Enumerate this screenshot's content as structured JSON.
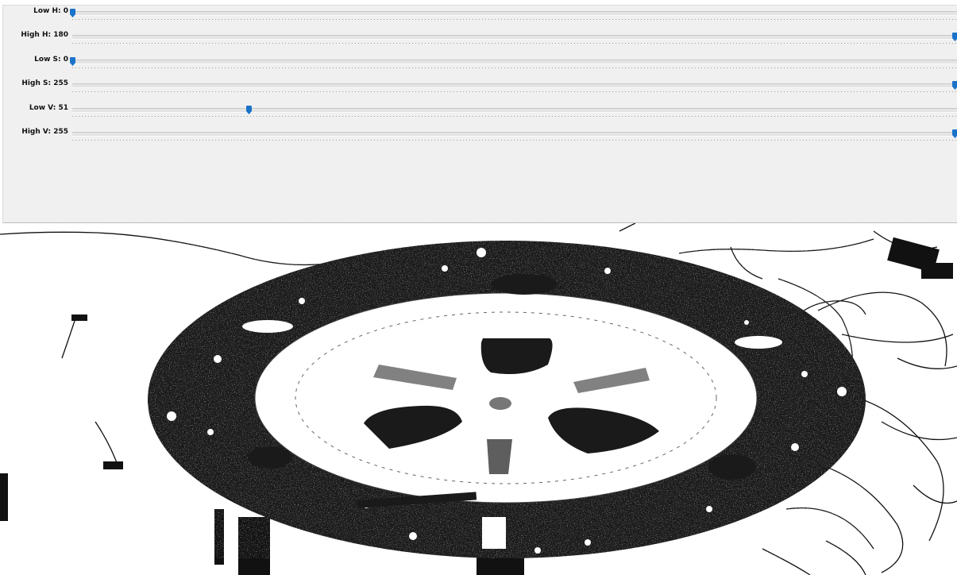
{
  "sliders": [
    {
      "label": "Low H: 0",
      "value": 0,
      "max": 180
    },
    {
      "label": "High H: 180",
      "value": 180,
      "max": 180
    },
    {
      "label": "Low S: 0",
      "value": 0,
      "max": 255
    },
    {
      "label": "High S: 255",
      "value": 255,
      "max": 255
    },
    {
      "label": "Low V: 51",
      "value": 51,
      "max": 255
    },
    {
      "label": "High V: 255",
      "value": 255,
      "max": 255
    }
  ],
  "colors": {
    "accent": "#1a73c9",
    "panel": "#f0f0f0"
  },
  "image": {
    "icon": "thresholded-image"
  }
}
